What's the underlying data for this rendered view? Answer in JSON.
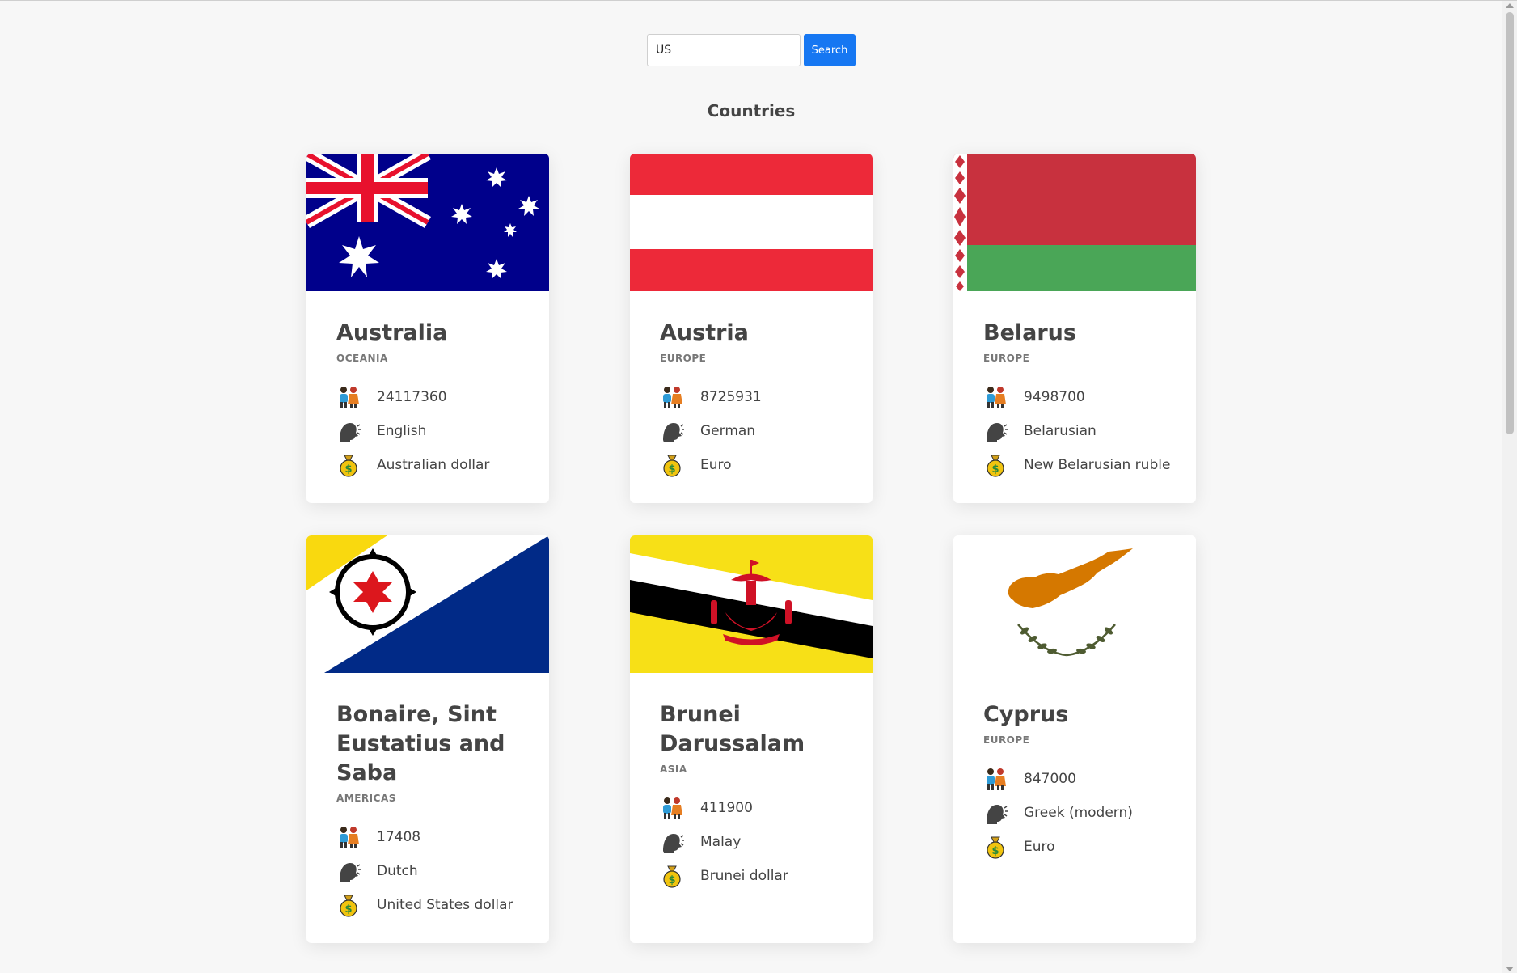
{
  "search": {
    "value": "US",
    "button_label": "Search"
  },
  "page_title": "Countries",
  "countries": [
    {
      "name": "Australia",
      "region": "OCEANIA",
      "population": "24117360",
      "language": "English",
      "currency": "Australian dollar",
      "flag": "australia-flag"
    },
    {
      "name": "Austria",
      "region": "EUROPE",
      "population": "8725931",
      "language": "German",
      "currency": "Euro",
      "flag": "austria-flag"
    },
    {
      "name": "Belarus",
      "region": "EUROPE",
      "population": "9498700",
      "language": "Belarusian",
      "currency": "New Belarusian ruble",
      "flag": "belarus-flag"
    },
    {
      "name": "Bonaire, Sint Eustatius and Saba",
      "region": "AMERICAS",
      "population": "17408",
      "language": "Dutch",
      "currency": "United States dollar",
      "flag": "bonaire-flag"
    },
    {
      "name": "Brunei Darussalam",
      "region": "ASIA",
      "population": "411900",
      "language": "Malay",
      "currency": "Brunei dollar",
      "flag": "brunei-flag"
    },
    {
      "name": "Cyprus",
      "region": "EUROPE",
      "population": "847000",
      "language": "Greek (modern)",
      "currency": "Euro",
      "flag": "cyprus-flag"
    }
  ],
  "icons": {
    "population": "people-icon",
    "language": "speaking-head-icon",
    "currency": "money-bag-icon"
  },
  "colors": {
    "accent": "#1677f2",
    "background": "#f7f7f7"
  }
}
